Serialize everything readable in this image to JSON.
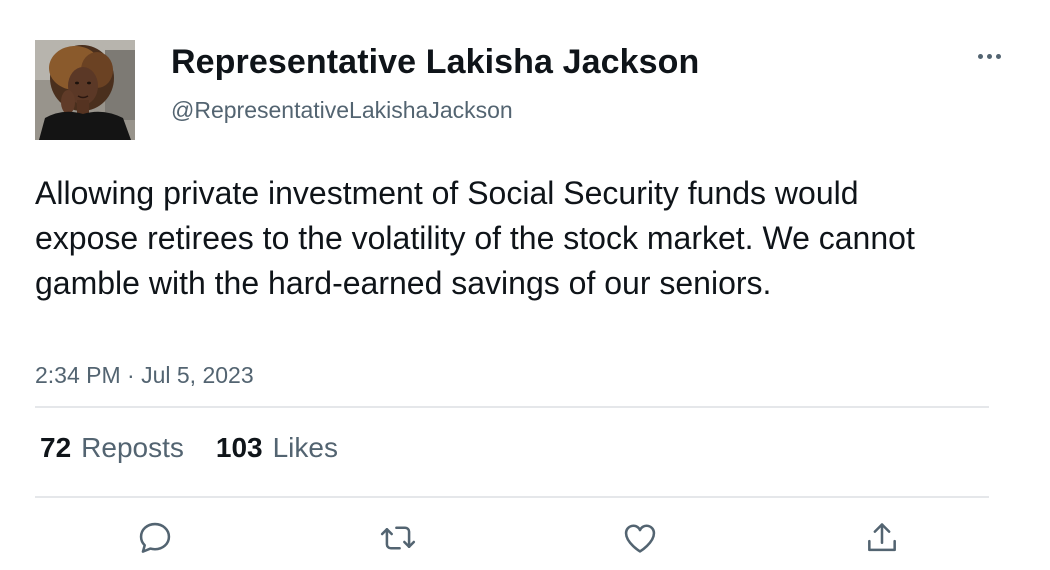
{
  "author": {
    "display_name": "Representative Lakisha Jackson",
    "handle": "@RepresentativeLakishaJackson",
    "avatar": "profile-photo"
  },
  "tweet": {
    "text": "Allowing private investment of Social Security funds would expose retirees to the volatility of the stock market. We cannot gamble with the hard-earned savings of our seniors.",
    "timestamp": "2:34 PM · Jul 5, 2023"
  },
  "stats": {
    "reposts_count": "72",
    "reposts_label": "Reposts",
    "likes_count": "103",
    "likes_label": "Likes"
  },
  "actions": {
    "more": "more-icon",
    "reply": "reply-icon",
    "repost": "repost-icon",
    "like": "like-icon",
    "share": "share-icon"
  },
  "colors": {
    "text_primary": "#0f1419",
    "text_secondary": "#536471",
    "divider": "#e5e7ea",
    "icon": "#536471"
  }
}
